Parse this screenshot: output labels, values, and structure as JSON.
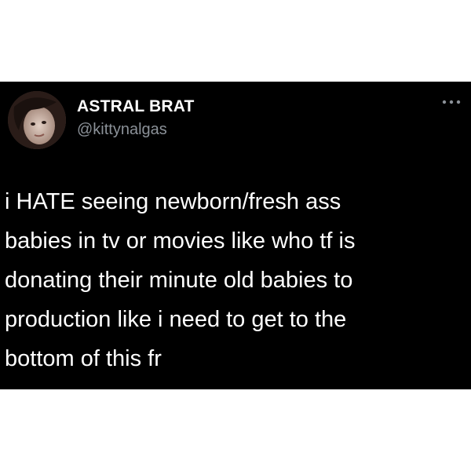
{
  "tweet": {
    "author": {
      "display_name": "ASTRAL BRAT",
      "handle": "@kittynalgas",
      "avatar_icon": "profile-photo"
    },
    "menu_icon": "more-options-icon",
    "text_lines": [
      "i HATE seeing newborn/fresh ass",
      "babies in tv or movies like who tf is",
      "donating their minute old babies to",
      "production like i need to get to the",
      "bottom of this fr"
    ]
  },
  "colors": {
    "card_background": "#000000",
    "page_background": "#ffffff",
    "text_primary": "#ffffff",
    "text_secondary": "#8b9198"
  }
}
